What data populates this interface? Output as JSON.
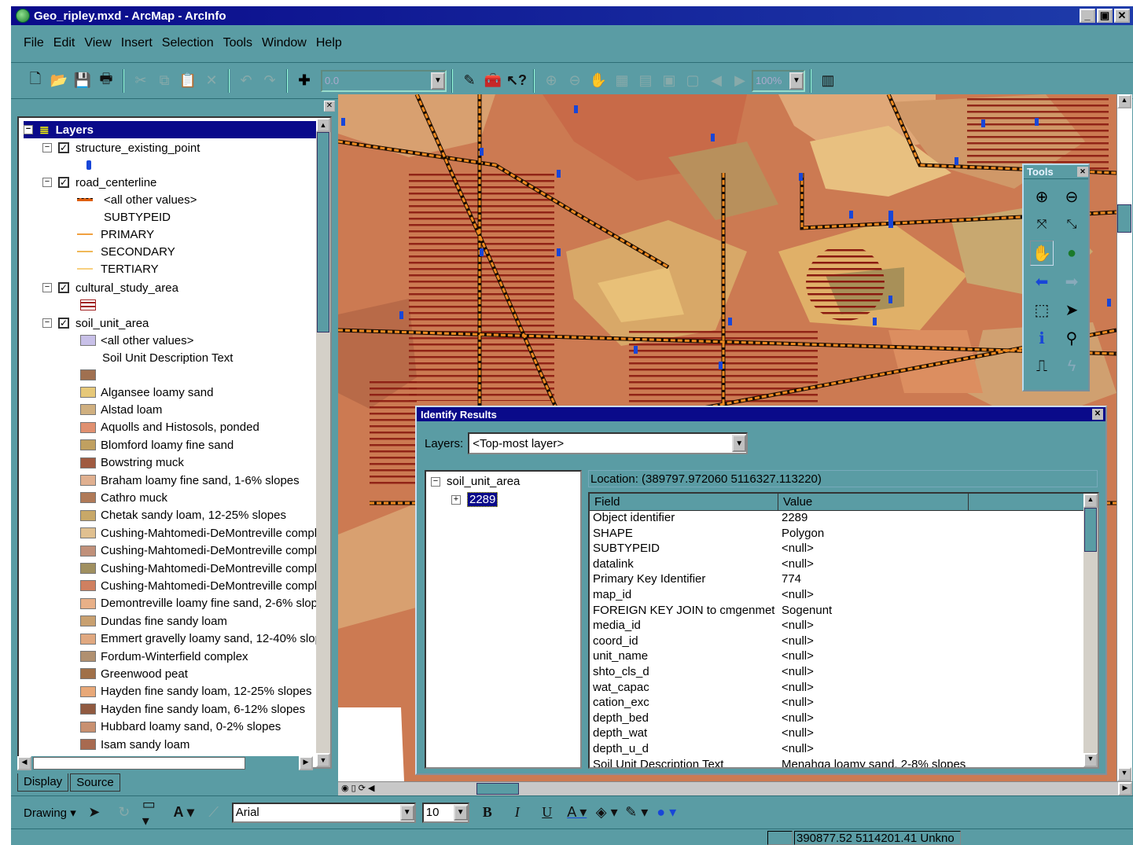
{
  "window": {
    "title": "Geo_ripley.mxd - ArcMap - ArcInfo",
    "minimize": "_",
    "restore": "▣",
    "close": "✕"
  },
  "menu": {
    "items": [
      "File",
      "Edit",
      "View",
      "Insert",
      "Selection",
      "Tools",
      "Window",
      "Help"
    ]
  },
  "toolbar": {
    "scale_value": "0.0",
    "zoom_value": "100%"
  },
  "toc": {
    "root_label": "Layers",
    "layers": [
      {
        "name": "structure_existing_point"
      },
      {
        "name": "road_centerline",
        "legend": [
          "<all other values>",
          "SUBTYPEID",
          "PRIMARY",
          "SECONDARY",
          "TERTIARY"
        ]
      },
      {
        "name": "cultural_study_area"
      },
      {
        "name": "soil_unit_area",
        "legend": [
          "<all other values>",
          "Soil Unit Description Text"
        ]
      }
    ],
    "soil_classes": [
      "Algansee loamy sand",
      "Alstad loam",
      "Aquolls and Histosols, ponded",
      "Blomford loamy fine sand",
      "Bowstring muck",
      "Braham loamy fine sand, 1-6% slopes",
      "Cathro muck",
      "Chetak sandy loam, 12-25% slopes",
      "Cushing-Mahtomedi-DeMontreville compl",
      "Cushing-Mahtomedi-DeMontreville compl",
      "Cushing-Mahtomedi-DeMontreville compl",
      "Cushing-Mahtomedi-DeMontreville compl",
      "Demontreville loamy fine sand, 2-6% slop",
      "Dundas fine sandy loam",
      "Emmert gravelly loamy sand, 12-40% slop",
      "Fordum-Winterfield complex",
      "Greenwood peat",
      "Hayden fine sandy loam, 12-25% slopes",
      "Hayden fine sandy loam, 6-12% slopes",
      "Hubbard loamy sand, 0-2% slopes",
      "Isam sandy loam"
    ],
    "soil_colors": [
      "#a07050",
      "#e6c878",
      "#d0b080",
      "#e09070",
      "#c0a060",
      "#a05a40",
      "#e0b090",
      "#b07a58",
      "#c8a868",
      "#e0c090",
      "#c0907a",
      "#a09060",
      "#d08060",
      "#e8b088",
      "#c8a070",
      "#e0a880",
      "#b09070",
      "#a07048",
      "#e8a878",
      "#905a40",
      "#c89070",
      "#a86a50"
    ],
    "tabs": [
      "Display",
      "Source"
    ]
  },
  "tools_palette": {
    "title": "Tools"
  },
  "identify": {
    "title": "Identify Results",
    "layers_label": "Layers:",
    "layers_value": "<Top-most layer>",
    "tree_layer": "soil_unit_area",
    "tree_feature": "2289",
    "location": "Location: (389797.972060 5116327.113220)",
    "columns": [
      "Field",
      "Value"
    ],
    "rows": [
      [
        "Object identifier",
        "2289"
      ],
      [
        "SHAPE",
        "Polygon"
      ],
      [
        "SUBTYPEID",
        "<null>"
      ],
      [
        "datalink",
        "<null>"
      ],
      [
        "Primary Key Identifier",
        "774"
      ],
      [
        "map_id",
        "<null>"
      ],
      [
        "FOREIGN KEY JOIN to cmgenmet",
        "Sogenunt"
      ],
      [
        "media_id",
        "<null>"
      ],
      [
        "coord_id",
        "<null>"
      ],
      [
        "unit_name",
        "<null>"
      ],
      [
        "shto_cls_d",
        "<null>"
      ],
      [
        "wat_capac",
        "<null>"
      ],
      [
        "cation_exc",
        "<null>"
      ],
      [
        "depth_bed",
        "<null>"
      ],
      [
        "depth_wat",
        "<null>"
      ],
      [
        "depth_u_d",
        "<null>"
      ],
      [
        "Soil Unit Description Text",
        "Menahga loamy sand, 2-8% slopes"
      ]
    ]
  },
  "drawing": {
    "label": "Drawing",
    "font": "Arial",
    "size": "10"
  },
  "status": {
    "coords": "390877.52  5114201.41 Unkno"
  }
}
